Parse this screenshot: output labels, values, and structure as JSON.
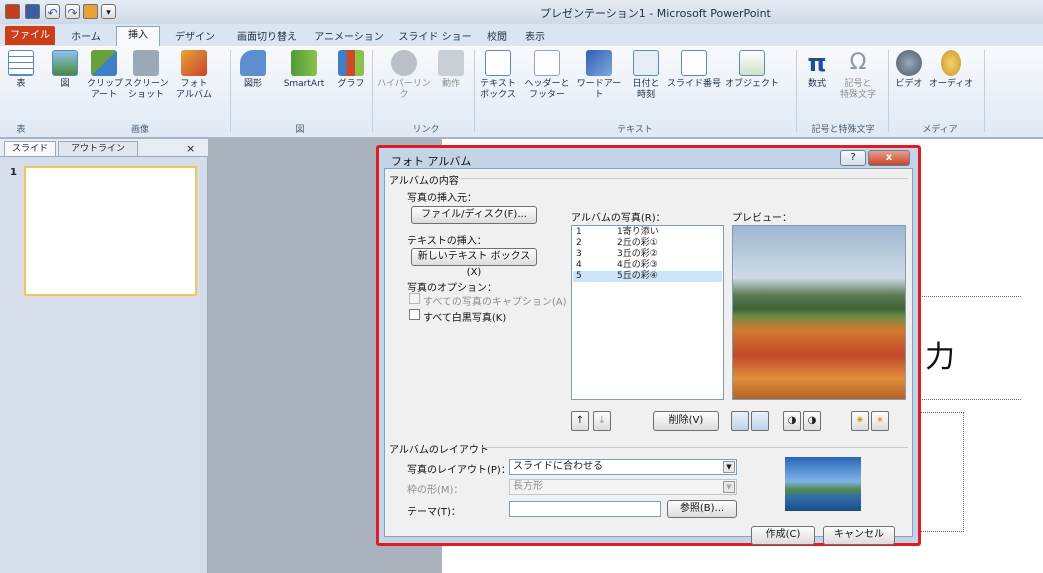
{
  "window": {
    "title": "プレゼンテーション1 - Microsoft PowerPoint"
  },
  "tabs": [
    {
      "label": "ファイル"
    },
    {
      "label": "ホーム"
    },
    {
      "label": "挿入"
    },
    {
      "label": "デザイン"
    },
    {
      "label": "画面切り替え"
    },
    {
      "label": "アニメーション"
    },
    {
      "label": "スライド ショー"
    },
    {
      "label": "校閲"
    },
    {
      "label": "表示"
    }
  ],
  "ribbon": {
    "buttons": [
      {
        "label": "表"
      },
      {
        "label": "図"
      },
      {
        "label": "クリップ\nアート"
      },
      {
        "label": "スクリーン\nショット"
      },
      {
        "label": "フォト\nアルバム"
      },
      {
        "label": "図形"
      },
      {
        "label": "SmartArt"
      },
      {
        "label": "グラフ"
      },
      {
        "label": "ハイパーリンク"
      },
      {
        "label": "動作"
      },
      {
        "label": "テキスト\nボックス"
      },
      {
        "label": "ヘッダーと\nフッター"
      },
      {
        "label": "ワードアート"
      },
      {
        "label": "日付と\n時刻"
      },
      {
        "label": "スライド番号"
      },
      {
        "label": "オブジェクト"
      },
      {
        "label": "数式"
      },
      {
        "label": "記号と\n特殊文字"
      },
      {
        "label": "ビデオ"
      },
      {
        "label": "オーディオ"
      }
    ],
    "groups": [
      {
        "label": "表"
      },
      {
        "label": "画像"
      },
      {
        "label": "図"
      },
      {
        "label": "リンク"
      },
      {
        "label": "テキスト"
      },
      {
        "label": "記号と特殊文字"
      },
      {
        "label": "メディア"
      }
    ]
  },
  "left_pane": {
    "tab_slides": "スライド",
    "tab_outline": "アウトライン",
    "close": "×",
    "slide_number": "1"
  },
  "slide": {
    "title_fragment": "力"
  },
  "dialog": {
    "title": "フォト アルバム",
    "help": "?",
    "close": "x",
    "content_group": "アルバムの内容",
    "insert_from": "写真の挿入元：",
    "file_disk_button": "ファイル/ディスク(F)...",
    "insert_text": "テキストの挿入：",
    "new_textbox_button": "新しいテキスト ボックス(X)",
    "photo_options": "写真のオプション：",
    "captions_option": "すべての写真のキャプション(A)",
    "bw_option": "すべて白黒写真(K)",
    "photos_in_album": "アルバムの写真(R)：",
    "photos": [
      {
        "num": "1",
        "name": "1寄り添い"
      },
      {
        "num": "2",
        "name": "2丘の彩①"
      },
      {
        "num": "3",
        "name": "3丘の彩②"
      },
      {
        "num": "4",
        "name": "4丘の彩③"
      },
      {
        "num": "5",
        "name": "5丘の彩④"
      }
    ],
    "selected_photo_index": 4,
    "preview_label": "プレビュー：",
    "move_up": "↑",
    "move_down": "↓",
    "delete_button": "削除(V)",
    "layout_group": "アルバムのレイアウト",
    "picture_layout_label": "写真のレイアウト(P)：",
    "picture_layout_value": "スライドに合わせる",
    "frame_shape_label": "枠の形(M)：",
    "frame_shape_value": "長方形",
    "theme_label": "テーマ(T)：",
    "theme_value": "",
    "browse_button": "参照(B)...",
    "create_button": "作成(C)",
    "cancel_button": "キャンセル"
  }
}
